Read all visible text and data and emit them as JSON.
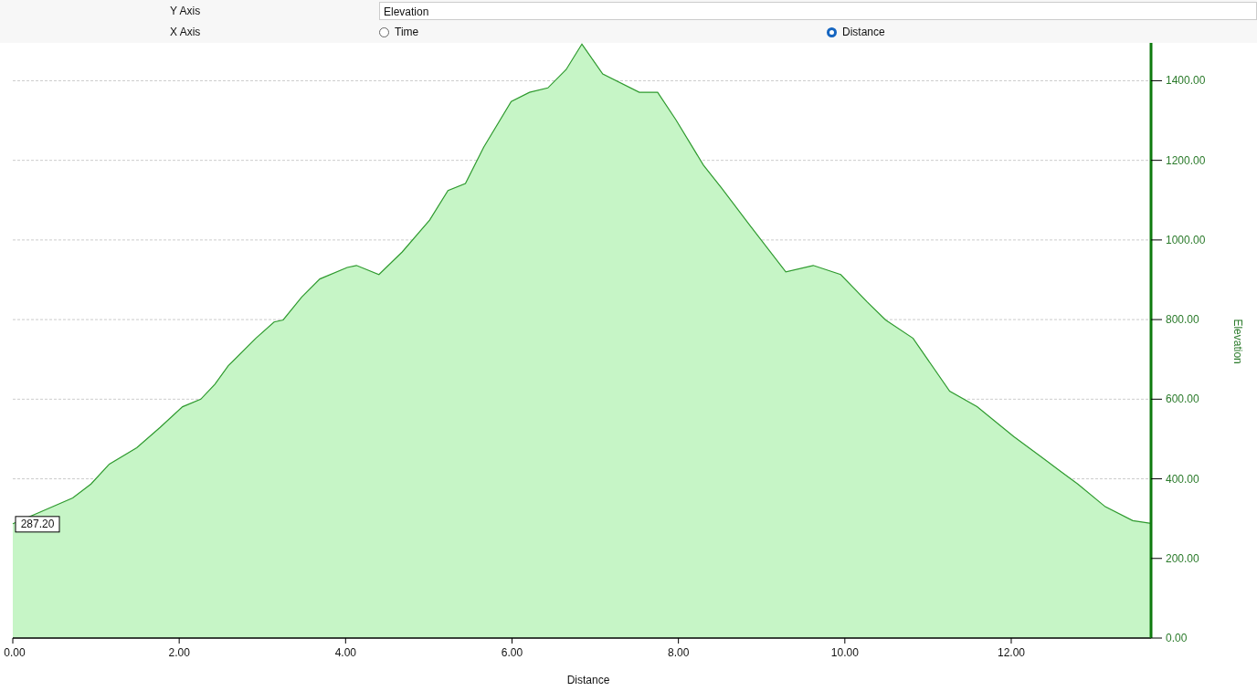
{
  "settings": {
    "y_axis": {
      "label": "Y Axis",
      "value": "Elevation"
    },
    "x_axis": {
      "label": "X Axis",
      "options": [
        {
          "label": "Time",
          "selected": false
        },
        {
          "label": "Distance",
          "selected": true
        }
      ]
    }
  },
  "chart": {
    "tooltip": "287.20",
    "chart_data": {
      "type": "area",
      "xlabel": "Distance",
      "ylabel": "Elevation",
      "xlim": [
        0,
        13.68
      ],
      "ylim": [
        0,
        1495
      ],
      "grid": true,
      "xticks": [
        {
          "value": 0,
          "label": "0.00"
        },
        {
          "value": 2,
          "label": "2.00"
        },
        {
          "value": 4,
          "label": "4.00"
        },
        {
          "value": 6,
          "label": "6.00"
        },
        {
          "value": 8,
          "label": "8.00"
        },
        {
          "value": 10,
          "label": "10.00"
        },
        {
          "value": 12,
          "label": "12.00"
        }
      ],
      "yticks": [
        {
          "value": 0,
          "label": "0.00"
        },
        {
          "value": 200,
          "label": "200.00"
        },
        {
          "value": 400,
          "label": "400.00"
        },
        {
          "value": 600,
          "label": "600.00"
        },
        {
          "value": 800,
          "label": "800.00"
        },
        {
          "value": 1000,
          "label": "1000.00"
        },
        {
          "value": 1200,
          "label": "1200.00"
        },
        {
          "value": 1400,
          "label": "1400.00"
        }
      ],
      "x": [
        0,
        0.29,
        0.72,
        0.94,
        1.16,
        1.49,
        1.77,
        2.04,
        2.26,
        2.43,
        2.59,
        2.92,
        3.14,
        3.25,
        3.47,
        3.69,
        4.02,
        4.13,
        4.4,
        4.68,
        5.01,
        5.23,
        5.44,
        5.66,
        5.99,
        6.21,
        6.43,
        6.65,
        6.84,
        7.09,
        7.53,
        7.75,
        7.97,
        8.3,
        8.52,
        8.85,
        9.29,
        9.62,
        9.95,
        10.27,
        10.49,
        10.82,
        11.26,
        11.59,
        12.03,
        12.36,
        12.58,
        12.8,
        13.13,
        13.46,
        13.68
      ],
      "series": [
        {
          "color": "#2e9a2e",
          "values": [
            287,
            313,
            352,
            387,
            437,
            478,
            529,
            581,
            600,
            638,
            684,
            753,
            794,
            799,
            856,
            902,
            931,
            936,
            913,
            970,
            1050,
            1124,
            1142,
            1233,
            1348,
            1371,
            1382,
            1428,
            1492,
            1417,
            1371,
            1371,
            1302,
            1188,
            1130,
            1039,
            920,
            936,
            913,
            844,
            799,
            753,
            620,
            581,
            506,
            455,
            421,
            387,
            330,
            295,
            288
          ]
        }
      ]
    }
  }
}
